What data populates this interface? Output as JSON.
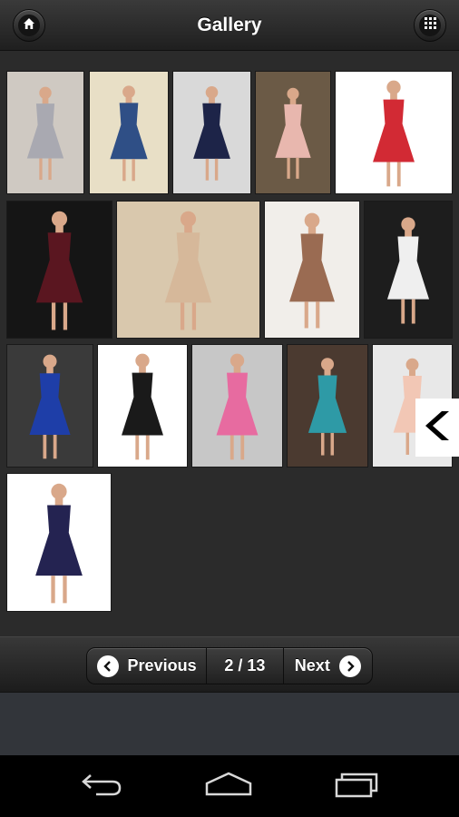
{
  "header": {
    "title": "Gallery",
    "left_icon": "home-icon",
    "right_icon": "grid-icon"
  },
  "gallery": {
    "thumbnails": [
      {
        "name": "thumb-silver-gown",
        "bg": "#cfc9c2",
        "dress": "#a9a9b1"
      },
      {
        "name": "thumb-navy-satin-dress",
        "bg": "#e8dfc6",
        "dress": "#2f4f86"
      },
      {
        "name": "thumb-navy-ruffle-dress",
        "bg": "#d9d9d9",
        "dress": "#1d2448"
      },
      {
        "name": "thumb-blush-short-dress",
        "bg": "#6b5a46",
        "dress": "#e8b7ae"
      },
      {
        "name": "thumb-red-lace-dress",
        "bg": "#ffffff",
        "dress": "#d22a34"
      },
      {
        "name": "thumb-burgundy-v-neck-dress",
        "bg": "#151515",
        "dress": "#5a1620"
      },
      {
        "name": "thumb-champagne-gown",
        "bg": "#d9c8ad",
        "dress": "#d6b89a"
      },
      {
        "name": "thumb-bronze-satin-dress",
        "bg": "#f1eeea",
        "dress": "#9a6b52"
      },
      {
        "name": "thumb-white-beaded-dress",
        "bg": "#1d1d1d",
        "dress": "#efefef"
      },
      {
        "name": "thumb-royal-blue-dress",
        "bg": "#3a3a3a",
        "dress": "#1e3ea8"
      },
      {
        "name": "thumb-black-hi-lo-dress",
        "bg": "#ffffff",
        "dress": "#1a1a1a"
      },
      {
        "name": "thumb-pastel-pair-dresses",
        "bg": "#c7c7c7",
        "dress": "#e76ba0"
      },
      {
        "name": "thumb-teal-hi-lo-dress",
        "bg": "#4b3a30",
        "dress": "#2e9aa6"
      },
      {
        "name": "thumb-peach-tulle-dress",
        "bg": "#e8e8e8",
        "dress": "#f2c7b5"
      },
      {
        "name": "thumb-navy-strapless-dress",
        "bg": "#ffffff",
        "dress": "#242351"
      }
    ],
    "side_arrow_icon": "chevron-left-icon"
  },
  "pager": {
    "previous_label": "Previous",
    "page_label": "2 / 13",
    "next_label": "Next"
  },
  "navbar": {
    "back_icon": "back-icon",
    "home_icon": "home-outline-icon",
    "recents_icon": "recents-icon"
  }
}
